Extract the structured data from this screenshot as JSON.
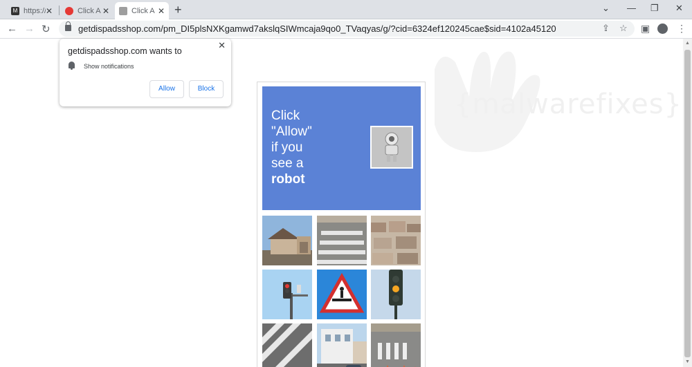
{
  "tabs": [
    {
      "title": "https://",
      "favicon": "malwarefixes-logo-icon"
    },
    {
      "title": "Click A",
      "favicon": "red-circle-icon"
    },
    {
      "title": "Click A",
      "favicon": "robot-thumbnail-icon"
    }
  ],
  "address_bar": {
    "url": "getdispadsshop.com/pm_DI5plsNXKgamwd7akslqSIWmcaja9qo0_TVaqyas/g/?cid=6324ef120245cae$sid=4102a45120"
  },
  "permission_prompt": {
    "title": "getdispadsshop.com wants to",
    "request": "Show notifications",
    "allow_label": "Allow",
    "block_label": "Block"
  },
  "watermark": {
    "text": "{malwarefixes}"
  },
  "captcha": {
    "banner_lines": [
      "Click",
      "\"Allow\"",
      "if you",
      "see a"
    ],
    "banner_bold": "robot",
    "banner_color": "#5b82d6",
    "tiles": [
      "house-photo",
      "crosswalk-photo",
      "rooftops-photo",
      "traffic-light-photo",
      "pedestrian-sign-photo",
      "traffic-signal-photo",
      "crosswalk-stripes-photo",
      "building-street-photo",
      "crosswalk-cones-photo"
    ]
  },
  "colors": {
    "tabstrip": "#dee1e6",
    "omnibox": "#f1f3f4",
    "link_blue": "#1a73e8"
  }
}
